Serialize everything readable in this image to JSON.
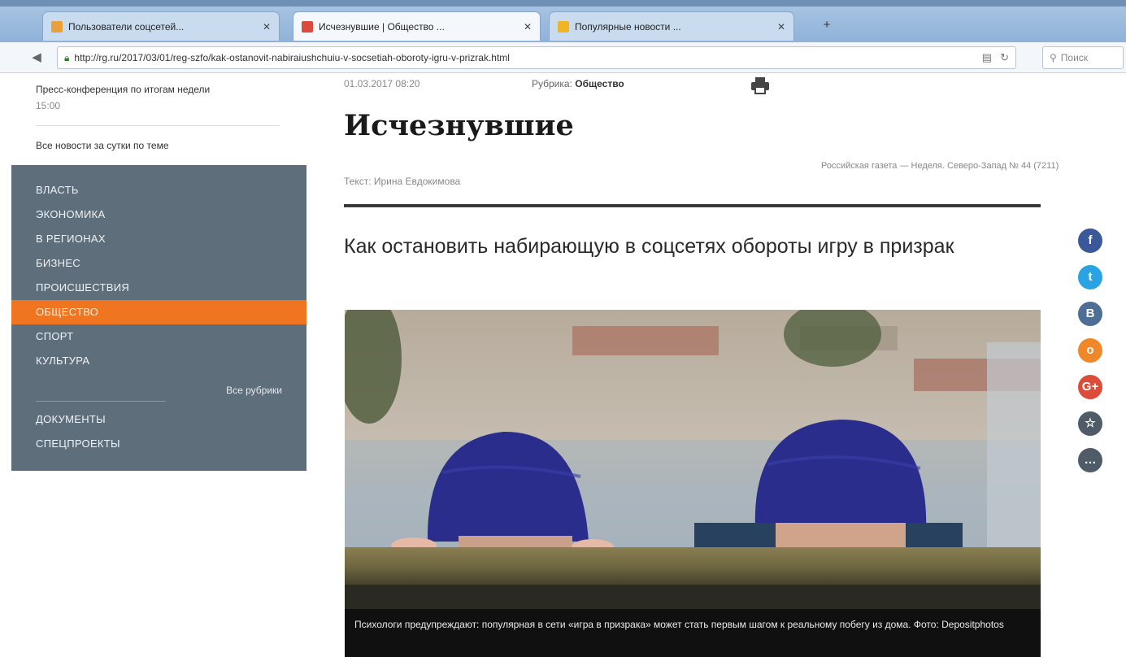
{
  "browser": {
    "tabs": [
      {
        "title": "Пользователи соцсетей...",
        "color": "#e8a13a"
      },
      {
        "title": "Исчезнувшие | Общество ...",
        "color": "#d94b3b"
      },
      {
        "title": "Популярные новости ...",
        "color": "#f0b429"
      }
    ],
    "newtab_label": "+",
    "url": "http://rg.ru/2017/03/01/reg-szfo/kak-ostanovit-nabiraiushchuiu-v-socsetiah-oboroty-igru-v-prizrak.html",
    "search_placeholder": "Поиск"
  },
  "sidebar": {
    "news": [
      {
        "text": "Пресс-конференция по итогам недели",
        "time": "15:00"
      },
      {
        "text": "Все новости за сутки по теме"
      }
    ],
    "rubrics": [
      {
        "label": "Власть",
        "active": false
      },
      {
        "label": "Экономика",
        "active": false
      },
      {
        "label": "В регионах",
        "active": false
      },
      {
        "label": "Бизнес",
        "active": false
      },
      {
        "label": "Происшествия",
        "active": false
      },
      {
        "label": "Общество",
        "active": true
      },
      {
        "label": "Спорт",
        "active": false
      },
      {
        "label": "Культура",
        "active": false
      }
    ],
    "all_rubrics": "Все рубрики",
    "extra": [
      "Документы",
      "Спецпроекты"
    ]
  },
  "article": {
    "date": "01.03.2017  08:20",
    "rubric_prefix": "Рубрика:",
    "rubric": "Общество",
    "title": "Исчезнувшие",
    "author": "Текст: Ирина Евдокимова",
    "issue": "Российская газета — Неделя. Северо-Запад № 44 (7211)",
    "lead": "Как остановить набирающую в соцсетях обороты игру в призрак",
    "caption": "Психологи предупреждают: популярная в сети «игра в призрака» может стать первым шагом к реальному побегу из дома. Фото: Depositphotos"
  },
  "share": [
    {
      "name": "facebook",
      "glyph": "f",
      "color": "#3b5998"
    },
    {
      "name": "twitter",
      "glyph": "t",
      "color": "#2aa3e3"
    },
    {
      "name": "vkontakte",
      "glyph": "B",
      "color": "#4d6f96"
    },
    {
      "name": "odnoklassniki",
      "glyph": "o",
      "color": "#f0882a"
    },
    {
      "name": "google-plus",
      "glyph": "G+",
      "color": "#dd4b39"
    },
    {
      "name": "bookmark",
      "glyph": "☆",
      "color": "#4f5b66"
    },
    {
      "name": "comments",
      "glyph": "…",
      "color": "#4f5b66"
    }
  ]
}
